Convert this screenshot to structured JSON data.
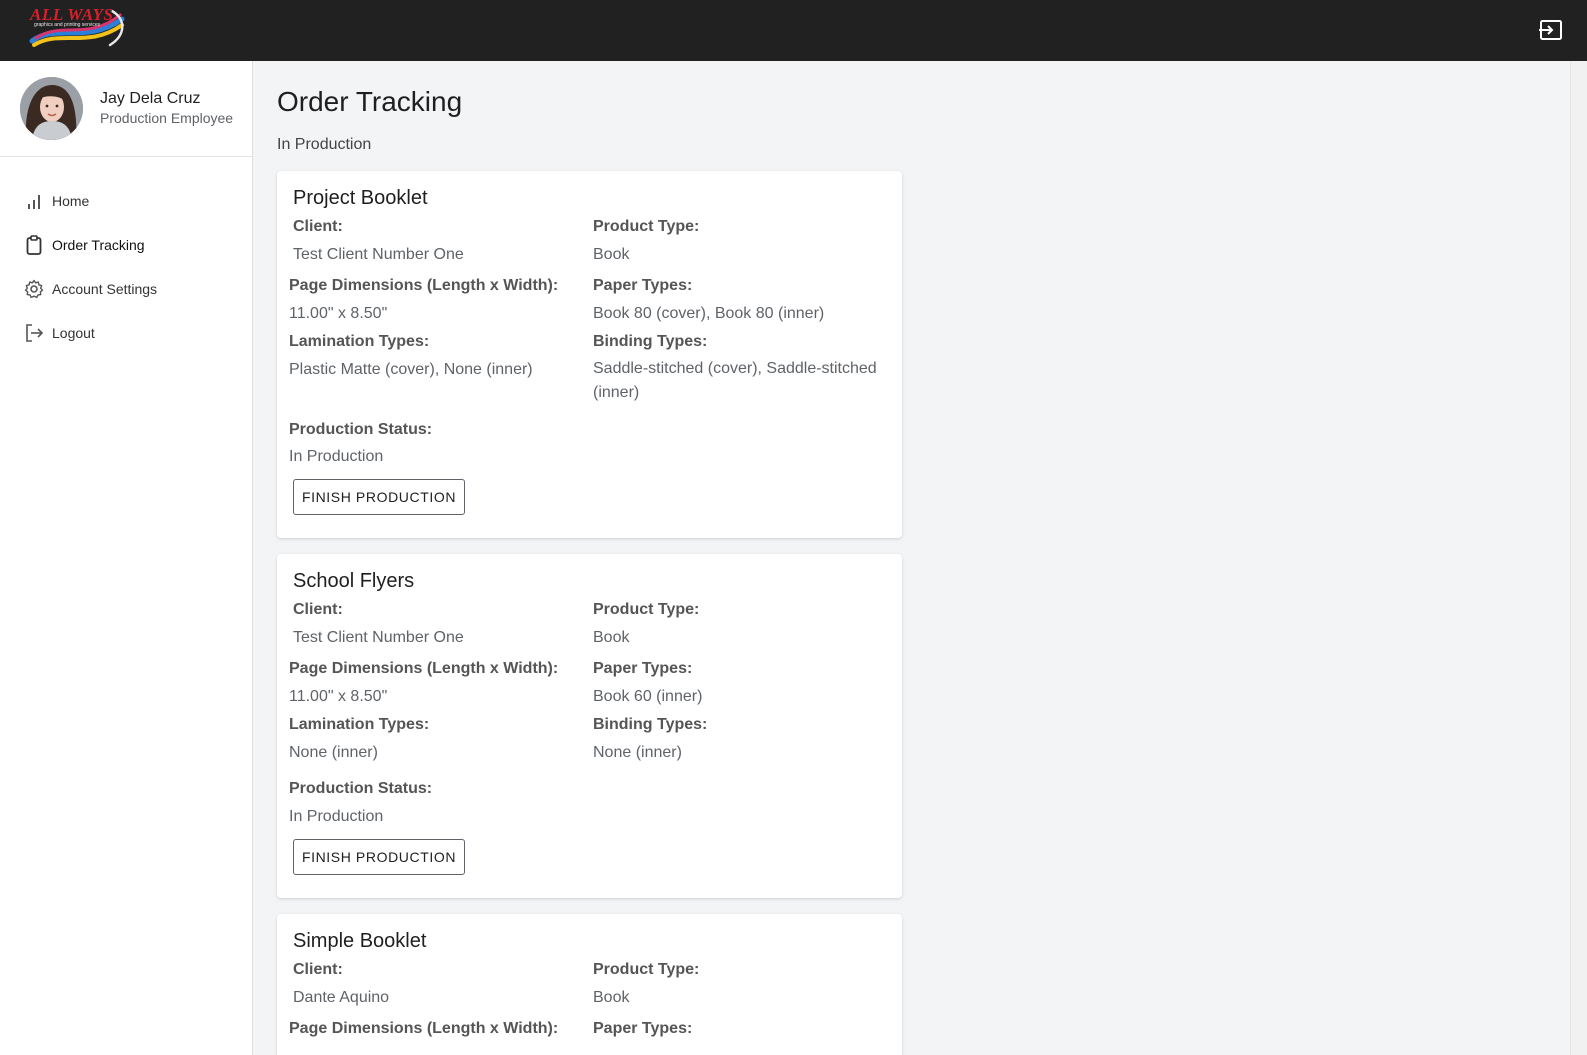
{
  "logo": {
    "text": "ALL WAYS",
    "sub": "graphics and printing services"
  },
  "user": {
    "name": "Jay Dela Cruz",
    "role": "Production Employee"
  },
  "nav": [
    {
      "label": "Home",
      "icon": "bar-chart-icon"
    },
    {
      "label": "Order Tracking",
      "icon": "clipboard-icon"
    },
    {
      "label": "Account Settings",
      "icon": "gear-icon"
    },
    {
      "label": "Logout",
      "icon": "logout-icon"
    }
  ],
  "page": {
    "title": "Order Tracking",
    "section": "In Production"
  },
  "labels": {
    "client": "Client:",
    "product_type": "Product Type:",
    "dimensions": "Page Dimensions (Length x Width):",
    "paper_types": "Paper Types:",
    "lamination_types": "Lamination Types:",
    "binding_types": "Binding Types:",
    "production_status": "Production Status:",
    "finish_button": "FINISH PRODUCTION"
  },
  "orders": [
    {
      "title": "Project Booklet",
      "client": "Test Client Number One",
      "product_type": "Book",
      "dimensions": "11.00\" x 8.50\"",
      "paper_types": "Book 80 (cover), Book 80 (inner)",
      "lamination_types": "Plastic Matte (cover), None (inner)",
      "binding_types": "Saddle-stitched (cover), Saddle-stitched (inner)",
      "production_status": "In Production"
    },
    {
      "title": "School Flyers",
      "client": "Test Client Number One",
      "product_type": "Book",
      "dimensions": "11.00\" x 8.50\"",
      "paper_types": "Book 60 (inner)",
      "lamination_types": "None (inner)",
      "binding_types": "None (inner)",
      "production_status": "In Production"
    },
    {
      "title": "Simple Booklet",
      "client": "Dante Aquino",
      "product_type": "Book"
    }
  ]
}
